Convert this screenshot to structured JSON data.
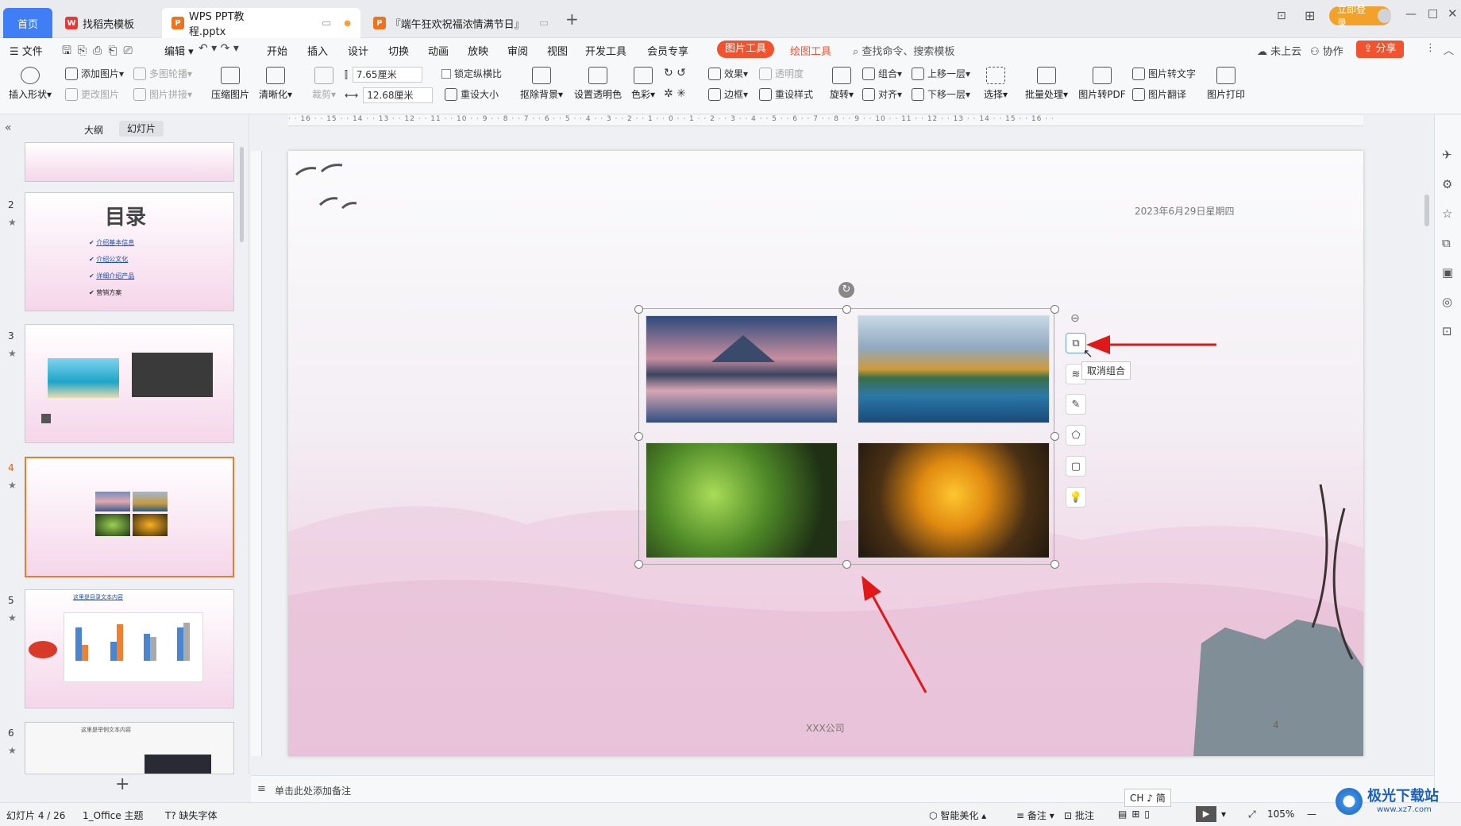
{
  "tabs": {
    "home": "首页",
    "tab1": "找稻壳模板",
    "tab2": "WPS PPT教程.pptx",
    "tab3": "『端午狂欢祝福浓情满节日』",
    "login": "立即登录"
  },
  "menu": {
    "file": "文件",
    "edit": "编辑",
    "items": [
      "开始",
      "插入",
      "设计",
      "切换",
      "动画",
      "放映",
      "审阅",
      "视图",
      "开发工具",
      "会员专享"
    ],
    "picture_tool": "图片工具",
    "draw_tool": "绘图工具",
    "search": "查找命令、搜索模板",
    "cloud": "未上云",
    "collab": "协作",
    "share": "分享"
  },
  "ribbon": {
    "insert_shape": "插入形状",
    "add_picture": "添加图片",
    "change_picture": "更改图片",
    "multi_outline": "多图轮播",
    "picture_mosaic": "图片拼接",
    "compress": "压缩图片",
    "clarity": "清晰化",
    "crop": "裁剪",
    "height": "7.65厘米",
    "width": "12.68厘米",
    "lock_ratio": "锁定纵横比",
    "reset_size": "重设大小",
    "remove_bg": "抠除背景",
    "set_transparent": "设置透明色",
    "color": "色彩",
    "effects": "效果",
    "transparency": "透明度",
    "border": "边框",
    "reset_style": "重设样式",
    "rotate": "旋转",
    "group": "组合",
    "align": "对齐",
    "bring_forward": "上移一层",
    "send_backward": "下移一层",
    "select": "选择",
    "batch": "批量处理",
    "to_pdf": "图片转PDF",
    "to_text": "图片转文字",
    "translate": "图片翻译",
    "print": "图片打印"
  },
  "panel": {
    "outline_tab": "大纲",
    "slides_tab": "幻灯片",
    "numbers": [
      "2",
      "3",
      "4",
      "5",
      "6"
    ],
    "slide2_title": "目录",
    "slide2_items": [
      "介绍基本信息",
      "介绍公文化",
      "详细介绍产品",
      "营销方案"
    ],
    "slide5_title": "这里是目录文本内容",
    "slide6_title": "这里是举例文本内容",
    "add": "+"
  },
  "slide": {
    "date": "2023年6月29日星期四",
    "company": "XXX公司",
    "page": "4",
    "tooltip": "取消组合"
  },
  "notes": "单击此处添加备注",
  "status": {
    "slide_count": "幻灯片 4 / 26",
    "theme": "1_Office 主题",
    "missing_font": "缺失字体",
    "smart_beautify": "智能美化",
    "notes": "备注",
    "comments": "批注",
    "zoom": "105%",
    "ime": "CH ♪ 简",
    "watermark": "极光下载站",
    "watermark_url": "www.xz7.com"
  }
}
